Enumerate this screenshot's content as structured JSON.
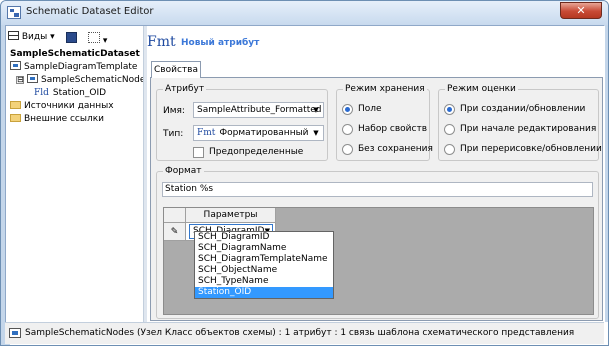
{
  "window": {
    "title": "Schematic Dataset Editor",
    "close_glyph": "✕"
  },
  "toolbar": {
    "views_label": "Виды",
    "views_arrow": "▾",
    "save_icon": "floppy-disk",
    "layout_arrow": "▾"
  },
  "tree": {
    "root": "SampleSchematicDataset",
    "items": [
      {
        "label": "SampleDiagramTemplate",
        "icon": "diagram"
      },
      {
        "label": "SampleSchematicNodes",
        "icon": "diagram-node",
        "expander": "⊟"
      },
      {
        "label": "Station_OID",
        "icon": "fld",
        "prefix": "Fld"
      },
      {
        "label": "Источники данных",
        "icon": "folder"
      },
      {
        "label": "Внешние ссылки",
        "icon": "folder"
      }
    ]
  },
  "attribute_header": {
    "type_badge": "Fmt",
    "title": "Новый атрибут"
  },
  "tabs": [
    {
      "label": "Свойства"
    }
  ],
  "attribute_group": {
    "legend": "Атрибут",
    "name_label": "Имя:",
    "name_value": "SampleAttribute_Formatted",
    "type_label": "Тип:",
    "type_value": "Форматированный",
    "type_badge": "Fmt",
    "predefined_label": "Предопределенные",
    "predefined_checked": false
  },
  "storage_group": {
    "legend": "Режим хранения",
    "options": [
      {
        "label": "Поле",
        "selected": true
      },
      {
        "label": "Набор свойств",
        "selected": false
      },
      {
        "label": "Без сохранения",
        "selected": false
      }
    ]
  },
  "evaluation_group": {
    "legend": "Режим оценки",
    "options": [
      {
        "label": "При создании/обновлении",
        "selected": true
      },
      {
        "label": "При начале редактирования",
        "selected": false
      },
      {
        "label": "При перерисовке/обновлении",
        "selected": false
      }
    ]
  },
  "format_group": {
    "legend": "Формат",
    "value": "Station %s"
  },
  "parameters_grid": {
    "column_header": "Параметры",
    "row_marker": "✎",
    "current_value": "SCH_DiagramID",
    "options": [
      "SCH_DiagramID",
      "SCH_DiagramName",
      "SCH_DiagramTemplateName",
      "SCH_ObjectName",
      "SCH_TypeName",
      "Station_OID"
    ],
    "highlighted_index": 5
  },
  "statusbar": {
    "text": "SampleSchematicNodes (Узел Класс объектов схемы) : 1 атрибут : 1 связь шаблона схематического представления"
  }
}
